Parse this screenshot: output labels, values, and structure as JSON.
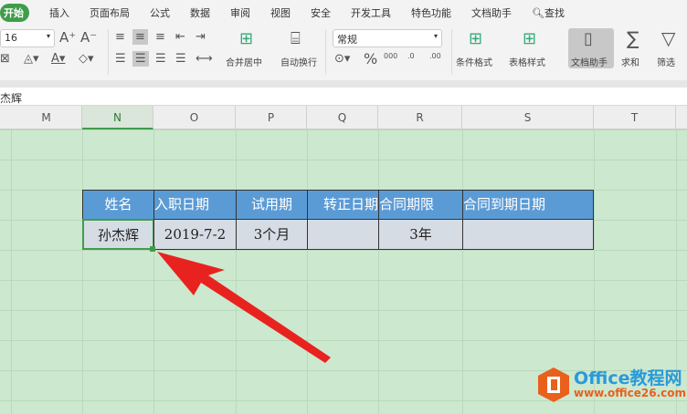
{
  "menu_tabs": [
    "开始",
    "插入",
    "页面布局",
    "公式",
    "数据",
    "审阅",
    "视图",
    "安全",
    "开发工具",
    "特色功能",
    "文档助手"
  ],
  "search_label": "查找",
  "ribbon": {
    "font_size": "16",
    "number_format": "常规",
    "merge_center": "合并居中",
    "wrap_text": "自动换行",
    "conditional_format": "条件格式",
    "table_style": "表格样式",
    "doc_assistant": "文档助手",
    "sum": "求和",
    "filter": "筛选",
    "percent": "%"
  },
  "formula_bar": {
    "value": "杰辉"
  },
  "columns": [
    "M",
    "N",
    "O",
    "P",
    "Q",
    "R",
    "S",
    "T"
  ],
  "table": {
    "headers": [
      "姓名",
      "入职日期",
      "试用期",
      "转正日期",
      "合同期限",
      "合同到期日期"
    ],
    "row": [
      "孙杰辉",
      "2019-7-2",
      "3个月",
      "",
      "3年",
      ""
    ]
  },
  "watermark": {
    "title": "Office教程网",
    "url": "www.office26.com"
  },
  "colors": {
    "accent": "#3f9d4a",
    "header_fill": "#5b9bd5",
    "cell_fill": "#d6dce4",
    "sheet_bg": "#cce8cf",
    "arrow": "#e8231f"
  }
}
